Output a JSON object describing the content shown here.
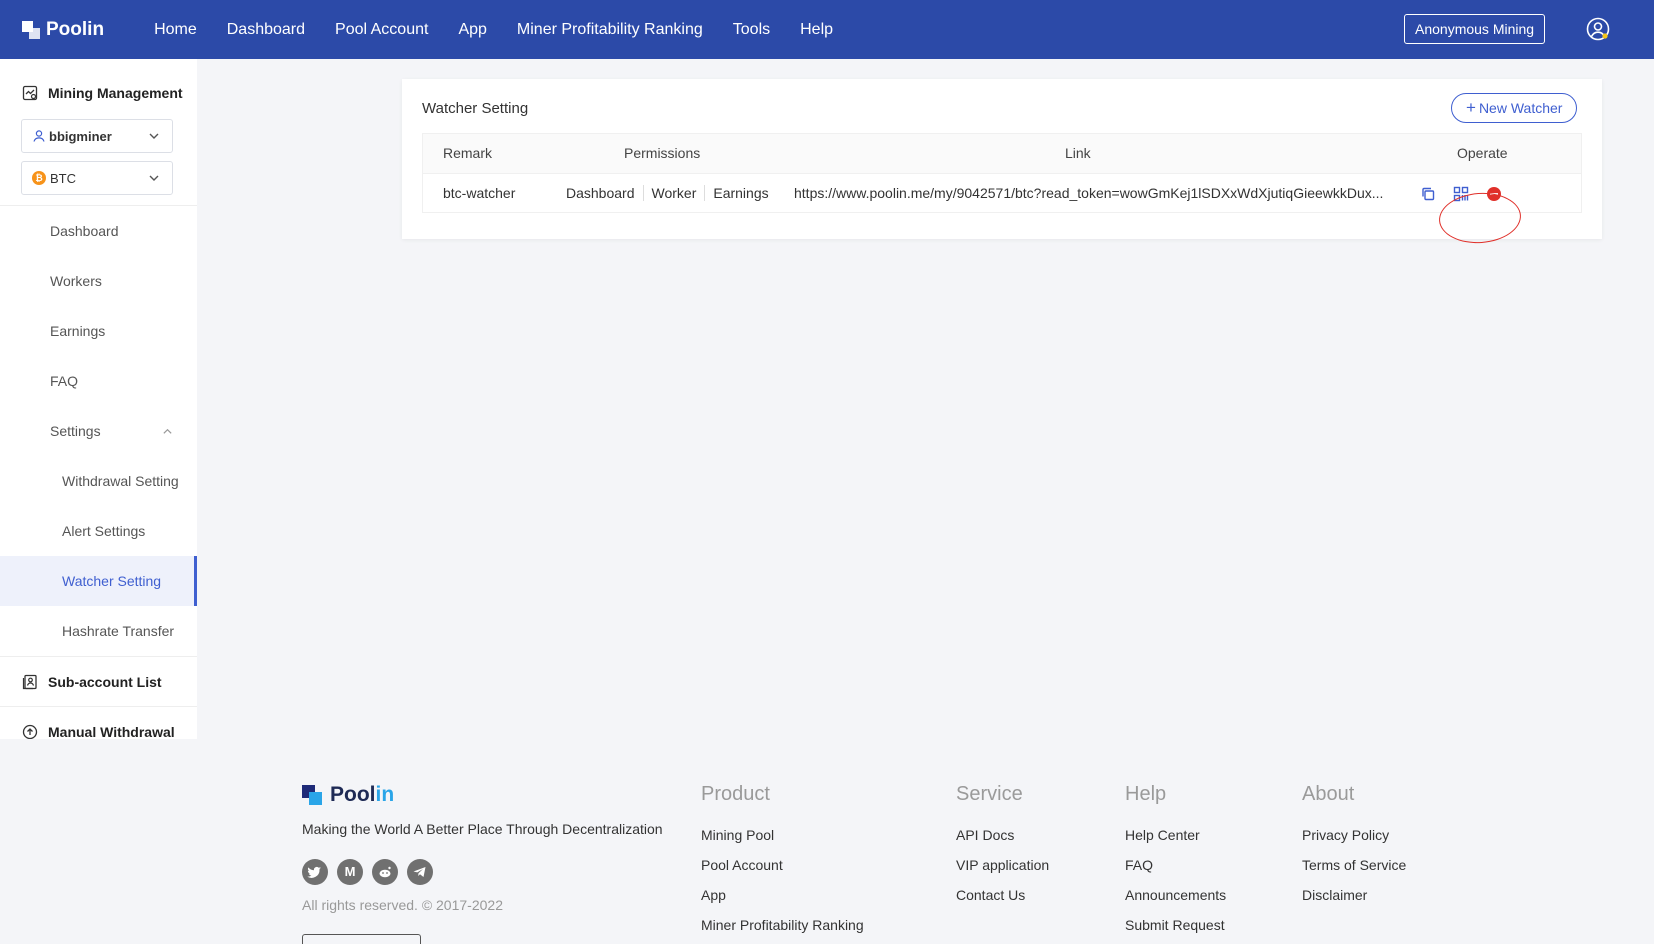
{
  "header": {
    "brand": "Poolin",
    "nav": [
      "Home",
      "Dashboard",
      "Pool Account",
      "App",
      "Miner Profitability Ranking",
      "Tools",
      "Help"
    ],
    "anonymous_btn": "Anonymous Mining"
  },
  "sidebar": {
    "section_title": "Mining Management",
    "account": "bbigminer",
    "coin": "BTC",
    "items": [
      "Dashboard",
      "Workers",
      "Earnings",
      "FAQ",
      "Settings"
    ],
    "sub_items": [
      "Withdrawal Setting",
      "Alert Settings",
      "Watcher Setting",
      "Hashrate Transfer"
    ],
    "sub_account_list": "Sub-account List",
    "manual_withdrawal": "Manual Withdrawal"
  },
  "main": {
    "title": "Watcher Setting",
    "new_watcher": "New Watcher",
    "columns": [
      "Remark",
      "Permissions",
      "Link",
      "Operate"
    ],
    "rows": [
      {
        "remark": "btc-watcher",
        "permissions": [
          "Dashboard",
          "Worker",
          "Earnings"
        ],
        "link": "https://www.poolin.me/my/9042571/btc?read_token=wowGmKej1lSDXxWdXjutiqGieewkkDux..."
      }
    ]
  },
  "footer": {
    "brand_a": "Pool",
    "brand_b": "in",
    "slogan": "Making the World A Better Place Through Decentralization",
    "rights": "All rights reserved. © 2017-2022",
    "columns": [
      {
        "title": "Product",
        "links": [
          "Mining Pool",
          "Pool Account",
          "App",
          "Miner Profitability Ranking"
        ]
      },
      {
        "title": "Service",
        "links": [
          "API Docs",
          "VIP application",
          "Contact Us"
        ]
      },
      {
        "title": "Help",
        "links": [
          "Help Center",
          "FAQ",
          "Announcements",
          "Submit Request"
        ]
      },
      {
        "title": "About",
        "links": [
          "Privacy Policy",
          "Terms of Service",
          "Disclaimer"
        ]
      }
    ],
    "social_letters": {
      "medium": "M"
    }
  },
  "colors": {
    "header_bg": "#2c4aa8",
    "accent": "#3f5fd0",
    "danger": "#e0302a"
  }
}
